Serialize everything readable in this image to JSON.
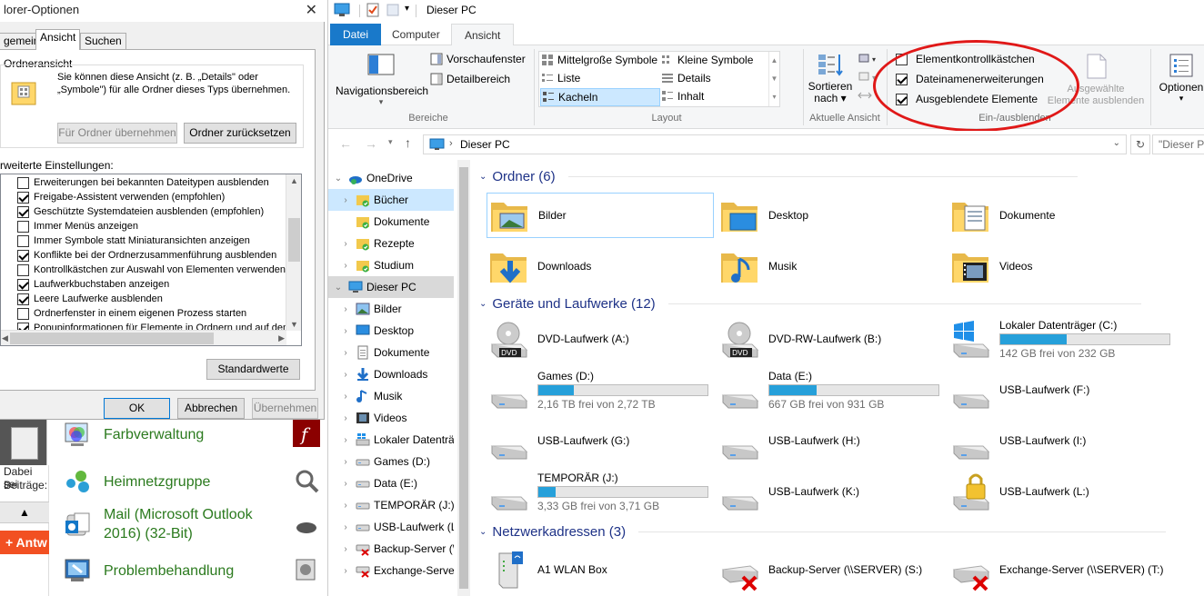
{
  "dialog": {
    "title": "lorer-Optionen",
    "tabs": [
      "gemein",
      "Ansicht",
      "Suchen"
    ],
    "folder_view_group": "Ordneransicht",
    "folder_view_desc_1": "Sie können diese Ansicht (z. B. „Details\" oder",
    "folder_view_desc_2": "„Symbole\") für alle Ordner dieses Typs übernehmen.",
    "apply_to_folders": "Für Ordner übernehmen",
    "reset_folders": "Ordner zurücksetzen",
    "advanced_label": "rweiterte Einstellungen:",
    "advanced_items": [
      {
        "label": "Erweiterungen bei bekannten Dateitypen ausblenden",
        "checked": false
      },
      {
        "label": "Freigabe-Assistent verwenden (empfohlen)",
        "checked": true
      },
      {
        "label": "Geschützte Systemdateien ausblenden (empfohlen)",
        "checked": true
      },
      {
        "label": "Immer Menüs anzeigen",
        "checked": false
      },
      {
        "label": "Immer Symbole statt Miniaturansichten anzeigen",
        "checked": false
      },
      {
        "label": "Konflikte bei der Ordnerzusammenführung ausblenden",
        "checked": true
      },
      {
        "label": "Kontrollkästchen zur Auswahl von Elementen verwenden",
        "checked": false
      },
      {
        "label": "Laufwerkbuchstaben anzeigen",
        "checked": true
      },
      {
        "label": "Leere Laufwerke ausblenden",
        "checked": true
      },
      {
        "label": "Ordnerfenster in einem eigenen Prozess starten",
        "checked": false
      },
      {
        "label": "Popupinformationen für Elemente in Ordnern und auf dem D",
        "checked": true
      }
    ],
    "defaults_button": "Standardwerte",
    "ok": "OK",
    "cancel": "Abbrechen",
    "apply": "Übernehmen",
    "close_glyph": "✕"
  },
  "control_panel": {
    "items": [
      "Farbverwaltung",
      "Heimnetzgruppe",
      "Mail (Microsoft Outlook 2016) (32-Bit)",
      "Problembehandlung"
    ],
    "left_text_1": "Dabei sei",
    "left_text_2": "Beiträge:",
    "reply_button": "+ Antw",
    "warn_glyph": "▲"
  },
  "explorer": {
    "window_title": "Dieser PC",
    "menu_tabs": [
      "Datei",
      "Computer",
      "Ansicht"
    ],
    "ribbon": {
      "nav_pane": "Navigationsbereich",
      "preview_pane": "Vorschaufenster",
      "details_pane": "Detailbereich",
      "group_panes": "Bereiche",
      "layouts": [
        "Mittelgroße Symbole",
        "Kleine Symbole",
        "Liste",
        "Details",
        "Kacheln",
        "Inhalt"
      ],
      "group_layout": "Layout",
      "sort_1": "Sortieren",
      "sort_2": "nach",
      "group_current_view": "Aktuelle Ansicht",
      "show_hide": [
        {
          "label": "Elementkontrollkästchen",
          "checked": false
        },
        {
          "label": "Dateinamenerweiterungen",
          "checked": true
        },
        {
          "label": "Ausgeblendete Elemente",
          "checked": true
        }
      ],
      "hide_selected_1": "Ausgewählte",
      "hide_selected_2": "Elemente ausblenden",
      "group_show_hide": "Ein-/ausblenden",
      "options": "Optionen"
    },
    "address": {
      "path": "Dieser PC",
      "search_placeholder": "\"Dieser P"
    },
    "nav": [
      {
        "label": "OneDrive",
        "chev": "⌄",
        "icon": "cloud",
        "indent": 0
      },
      {
        "label": "Bücher",
        "chev": "›",
        "icon": "folder-green",
        "indent": 1,
        "sel": "hover"
      },
      {
        "label": "Dokumente",
        "chev": "",
        "icon": "folder-green",
        "indent": 1
      },
      {
        "label": "Rezepte",
        "chev": "›",
        "icon": "folder-green",
        "indent": 1
      },
      {
        "label": "Studium",
        "chev": "›",
        "icon": "folder-green",
        "indent": 1
      },
      {
        "label": "Dieser PC",
        "chev": "⌄",
        "icon": "pc",
        "indent": 0,
        "sel": "selected"
      },
      {
        "label": "Bilder",
        "chev": "›",
        "icon": "pictures",
        "indent": 1
      },
      {
        "label": "Desktop",
        "chev": "›",
        "icon": "desktop",
        "indent": 1
      },
      {
        "label": "Dokumente",
        "chev": "›",
        "icon": "documents",
        "indent": 1
      },
      {
        "label": "Downloads",
        "chev": "›",
        "icon": "downloads",
        "indent": 1
      },
      {
        "label": "Musik",
        "chev": "›",
        "icon": "music",
        "indent": 1
      },
      {
        "label": "Videos",
        "chev": "›",
        "icon": "videos",
        "indent": 1
      },
      {
        "label": "Lokaler Datenträ",
        "chev": "›",
        "icon": "windrive",
        "indent": 1
      },
      {
        "label": "Games (D:)",
        "chev": "›",
        "icon": "drive",
        "indent": 1
      },
      {
        "label": "Data (E:)",
        "chev": "›",
        "icon": "drive",
        "indent": 1
      },
      {
        "label": "TEMPORÄR (J:)",
        "chev": "›",
        "icon": "drive",
        "indent": 1
      },
      {
        "label": "USB-Laufwerk (L",
        "chev": "›",
        "icon": "drive",
        "indent": 1
      },
      {
        "label": "Backup-Server (\\",
        "chev": "›",
        "icon": "netdrive",
        "indent": 1
      },
      {
        "label": "Exchange-Server",
        "chev": "›",
        "icon": "netdrive",
        "indent": 1
      }
    ],
    "sections": {
      "folders": "Ordner (6)",
      "drives": "Geräte und Laufwerke (12)",
      "network": "Netzwerkadressen (3)"
    },
    "folders": [
      "Bilder",
      "Desktop",
      "Dokumente",
      "Downloads",
      "Musik",
      "Videos"
    ],
    "drives": [
      {
        "name": "DVD-Laufwerk (A:)",
        "type": "dvd"
      },
      {
        "name": "DVD-RW-Laufwerk (B:)",
        "type": "dvd"
      },
      {
        "name": "Lokaler Datenträger (C:)",
        "type": "win",
        "free": "142 GB frei von 232 GB",
        "used_fraction": 0.39
      },
      {
        "name": "Games (D:)",
        "type": "hdd",
        "free": "2,16 TB frei von 2,72 TB",
        "used_fraction": 0.21
      },
      {
        "name": "Data (E:)",
        "type": "hdd",
        "free": "667 GB frei von 931 GB",
        "used_fraction": 0.28
      },
      {
        "name": "USB-Laufwerk (F:)",
        "type": "usb"
      },
      {
        "name": "USB-Laufwerk (G:)",
        "type": "usb"
      },
      {
        "name": "USB-Laufwerk (H:)",
        "type": "usb"
      },
      {
        "name": "USB-Laufwerk (I:)",
        "type": "usb"
      },
      {
        "name": "TEMPORÄR (J:)",
        "type": "hdd",
        "free": "3,33 GB frei von 3,71 GB",
        "used_fraction": 0.1
      },
      {
        "name": "USB-Laufwerk (K:)",
        "type": "usb"
      },
      {
        "name": "USB-Laufwerk (L:)",
        "type": "lock"
      }
    ],
    "network": [
      "A1 WLAN Box",
      "Backup-Server (\\\\SERVER) (S:)",
      "Exchange-Server (\\\\SERVER) (T:)"
    ],
    "colors": {
      "accent": "#1979ca",
      "annotation": "#e01818",
      "heading": "#1e3287",
      "cp_green": "#2b7a1e",
      "bar_fill": "#26a0da"
    }
  }
}
